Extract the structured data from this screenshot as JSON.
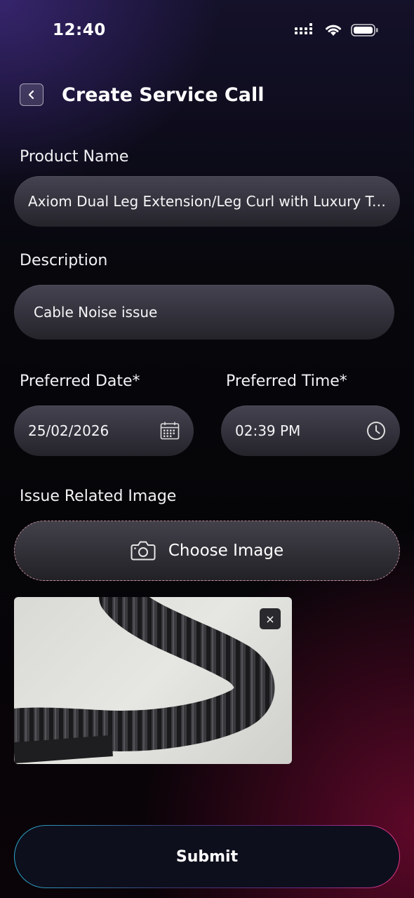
{
  "status_bar": {
    "time": "12:40"
  },
  "header": {
    "title": "Create Service Call"
  },
  "form": {
    "product_name_label": "Product Name",
    "product_name_value": "Axiom Dual Leg Extension/Leg Curl with Luxury Trim...",
    "description_label": "Description",
    "description_value": "Cable Noise issue",
    "date_label": "Preferred Date*",
    "date_value": "25/02/2026",
    "time_label": "Preferred Time*",
    "time_value": "02:39 PM",
    "image_label": "Issue Related Image",
    "choose_image_label": "Choose Image",
    "remove_image_label": "×",
    "submit_label": "Submit"
  },
  "icons": [
    "signal-icon",
    "wifi-icon",
    "battery-icon",
    "chevron-left-icon",
    "calendar-icon",
    "clock-icon",
    "camera-icon",
    "close-icon"
  ],
  "colors": {
    "submit_border_start": "#2aa8c8",
    "submit_border_end": "#e0388a",
    "dashed_border": "#f0aab9"
  }
}
